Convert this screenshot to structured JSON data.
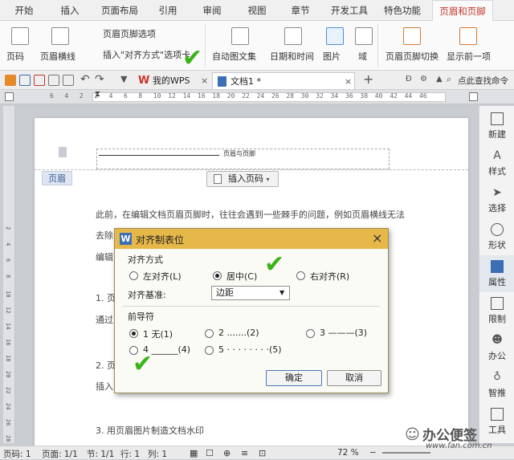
{
  "ribbon_tabs": [
    "开始",
    "插入",
    "页面布局",
    "引用",
    "审阅",
    "视图",
    "章节",
    "开发工具",
    "特色功能",
    "页眉和页脚"
  ],
  "ribbon": {
    "page_number": "页码",
    "header_line": "页眉横线",
    "header_footer_options": "页眉页脚选项",
    "insert_align_tab": "插入\"对齐方式\"选项卡",
    "auto_text": "自动图文集",
    "date_time": "日期和时间",
    "picture": "图片",
    "field": "域",
    "header_footer_switch": "页眉页脚切换",
    "show_prev": "显示前一项"
  },
  "quickbar": {
    "my_wps_tab": "我的WPS",
    "doc_tab": "文档1 *",
    "search_hint": "点此查找命令"
  },
  "ruler_numbers": [
    "6",
    "4",
    "2",
    "2",
    "4",
    "6",
    "8",
    "10",
    "12",
    "14",
    "16",
    "18",
    "20",
    "22",
    "24",
    "26",
    "28",
    "30",
    "32",
    "34",
    "36",
    "38",
    "40",
    "42",
    "44",
    "46"
  ],
  "vruler_numbers": [
    "2",
    "4",
    "6",
    "8",
    "10",
    "12",
    "14",
    "16",
    "18",
    "20",
    "22",
    "24",
    "26",
    "28"
  ],
  "document": {
    "header_text": "页眉与页脚",
    "header_badge": "页眉",
    "insert_page_number_btn": "插入页码",
    "paragraph_1": "此前，在编辑文档页眉页脚时，往往会遇到一些棘手的问题，例如页眉横线无法",
    "line_2": "去除",
    "line_3": "编辑",
    "line_4": "1. 页",
    "line_5": "通过",
    "line_6": "2. 页",
    "line_7": "插入",
    "line_8": "3. 用页眉图片制造文档水印"
  },
  "dialog": {
    "title": "对齐制表位",
    "align_group": "对齐方式",
    "left_align": "左对齐(L)",
    "center_align": "居中(C)",
    "right_align": "右对齐(R)",
    "basis_label": "对齐基准:",
    "basis_value": "边距",
    "leader_group": "前导符",
    "leader_1": "1 无(1)",
    "leader_2": "2 .......(2)",
    "leader_3": "3 ———(3)",
    "leader_4": "4 ______(4)",
    "leader_5": "5 · · · · · · · ·(5)",
    "ok": "确定",
    "cancel": "取消",
    "selected_align": "center",
    "selected_leader": "1"
  },
  "sidebar": [
    "新建",
    "样式",
    "选择",
    "形状",
    "属性",
    "限制",
    "办公",
    "智推",
    "工具"
  ],
  "status": {
    "page_num": "页码: 1",
    "page": "页面: 1/1",
    "section": "节: 1/1",
    "row": "行: 1",
    "column": "列: 1",
    "zoom": "72 %"
  },
  "watermark": "办公便签",
  "watermark_url": "www.fan.com.cn",
  "colors": {
    "dialog_title": "#e6b84a",
    "active_tab_text": "#c0392b",
    "check": "#3ab319",
    "wps_red": "#d0312d"
  }
}
